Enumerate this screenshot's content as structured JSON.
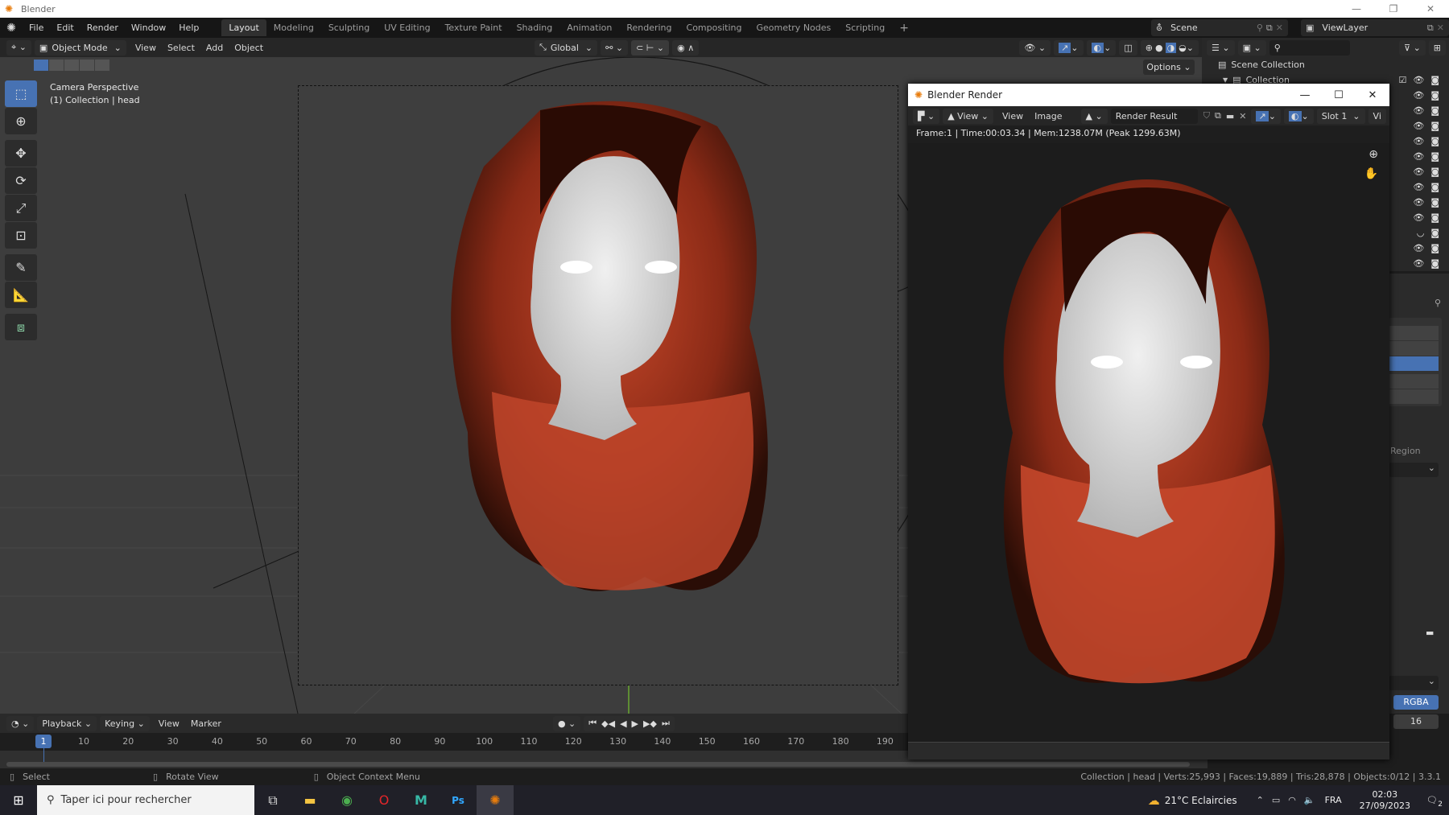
{
  "window": {
    "title": "Blender",
    "controls": [
      "minimize",
      "restore",
      "close"
    ]
  },
  "menubar": {
    "items": [
      "File",
      "Edit",
      "Render",
      "Window",
      "Help"
    ],
    "workspaces": [
      "Layout",
      "Modeling",
      "Sculpting",
      "UV Editing",
      "Texture Paint",
      "Shading",
      "Animation",
      "Rendering",
      "Compositing",
      "Geometry Nodes",
      "Scripting"
    ],
    "active_workspace": "Layout",
    "add_workspace": "+",
    "scene": "Scene",
    "view_layer": "ViewLayer"
  },
  "viewport_header": {
    "mode": "Object Mode",
    "menus": [
      "View",
      "Select",
      "Add",
      "Object"
    ],
    "orientation": "Global",
    "options": "Options"
  },
  "viewport": {
    "camera_label": "Camera Perspective",
    "collection_label": "(1) Collection | head",
    "tools": [
      "select-box",
      "cursor",
      "move",
      "rotate",
      "scale",
      "transform",
      "annotate",
      "measure",
      "add-cube"
    ]
  },
  "outliner": {
    "rows": [
      {
        "label": "Scene Collection"
      },
      {
        "label": "Collection"
      }
    ],
    "visibility_rows": 13
  },
  "properties": {
    "region_label": "Region",
    "color_mode": "RGBA",
    "color_depth": "16"
  },
  "render_window": {
    "title": "Blender Render",
    "menus": [
      "View",
      "View",
      "Image"
    ],
    "image_name": "Render Result",
    "slot": "Slot 1",
    "view_trunc": "Vi",
    "info": "Frame:1 | Time:00:03.34 | Mem:1238.07M (Peak 1299.63M)"
  },
  "timeline": {
    "menus": [
      "Playback",
      "Keying",
      "View",
      "Marker"
    ],
    "current_frame": "1",
    "ticks": [
      "10",
      "20",
      "30",
      "40",
      "50",
      "60",
      "70",
      "80",
      "90",
      "100",
      "110",
      "120",
      "130",
      "140",
      "150",
      "160",
      "170",
      "180",
      "190"
    ]
  },
  "statusbar": {
    "hints": [
      "Select",
      "Rotate View",
      "Object Context Menu"
    ],
    "stats": "Collection | head | Verts:25,993 | Faces:19,889 | Tris:28,878 | Objects:0/12 | 3.3.1"
  },
  "taskbar": {
    "search_placeholder": "Taper ici pour rechercher",
    "weather": "21°C  Eclaircies",
    "lang": "FRA",
    "time": "02:03",
    "date": "27/09/2023",
    "notif_count": "2"
  }
}
